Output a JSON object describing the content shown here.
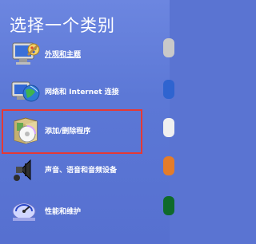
{
  "title": "选择一个类别",
  "categories": [
    {
      "label": "外观和主题",
      "icon": "appearance-themes-icon",
      "underline": true
    },
    {
      "label": "网络和 Internet 连接",
      "icon": "network-internet-icon",
      "underline": false
    },
    {
      "label": "添加/删除程序",
      "icon": "add-remove-programs-icon",
      "underline": false
    },
    {
      "label": "声音、语音和音频设备",
      "icon": "sounds-audio-icon",
      "underline": false
    },
    {
      "label": "性能和维护",
      "icon": "performance-maintenance-icon",
      "underline": false
    }
  ],
  "colors": {
    "background": "#5a74d2",
    "highlight": "#e53935",
    "text": "#ffffff"
  }
}
